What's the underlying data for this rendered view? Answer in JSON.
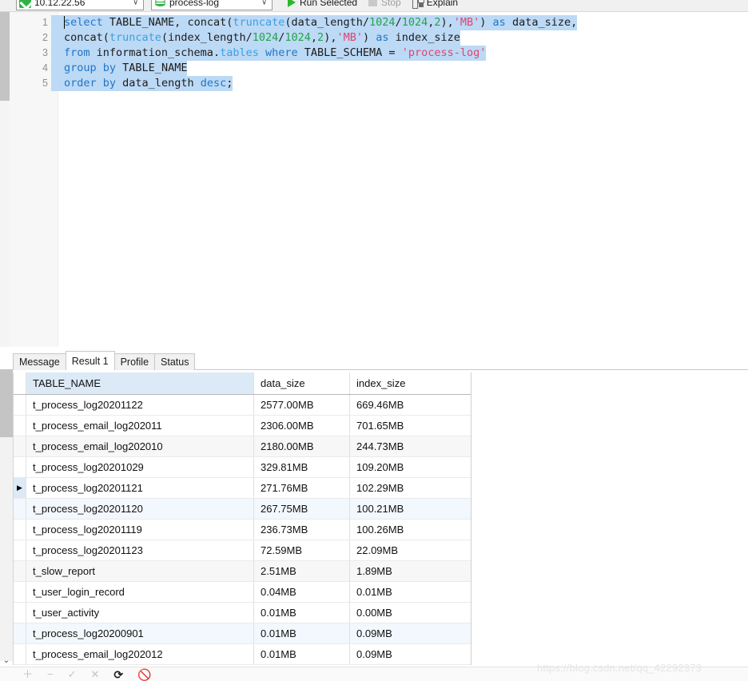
{
  "toolbar": {
    "connection": {
      "value": "10.12.22.56",
      "icon": "plug-icon",
      "arrow": "∨"
    },
    "database": {
      "value": "process-log",
      "icon": "database-icon",
      "arrow": "∨"
    },
    "run_selected_label": "Run Selected",
    "stop_label": "Stop",
    "explain_label": "Explain"
  },
  "editor": {
    "line_numbers": [
      "1",
      "2",
      "3",
      "4",
      "5"
    ],
    "lines": [
      {
        "n": "1",
        "tokens": [
          {
            "t": "select ",
            "c": "kw"
          },
          {
            "t": "TABLE_NAME, concat(",
            "c": "pl"
          },
          {
            "t": "truncate",
            "c": "fn"
          },
          {
            "t": "(data_length/",
            "c": "pl"
          },
          {
            "t": "1024",
            "c": "num"
          },
          {
            "t": "/",
            "c": "pl"
          },
          {
            "t": "1024",
            "c": "num"
          },
          {
            "t": ",",
            "c": "pl"
          },
          {
            "t": "2",
            "c": "num"
          },
          {
            "t": "),",
            "c": "pl"
          },
          {
            "t": "'MB'",
            "c": "str"
          },
          {
            "t": ") ",
            "c": "pl"
          },
          {
            "t": "as ",
            "c": "kw"
          },
          {
            "t": "data_size,",
            "c": "pl"
          }
        ]
      },
      {
        "n": "2",
        "tokens": [
          {
            "t": "concat(",
            "c": "pl"
          },
          {
            "t": "truncate",
            "c": "fn"
          },
          {
            "t": "(index_length/",
            "c": "pl"
          },
          {
            "t": "1024",
            "c": "num"
          },
          {
            "t": "/",
            "c": "pl"
          },
          {
            "t": "1024",
            "c": "num"
          },
          {
            "t": ",",
            "c": "pl"
          },
          {
            "t": "2",
            "c": "num"
          },
          {
            "t": "),",
            "c": "pl"
          },
          {
            "t": "'MB'",
            "c": "str"
          },
          {
            "t": ") ",
            "c": "pl"
          },
          {
            "t": "as ",
            "c": "kw"
          },
          {
            "t": "index_size",
            "c": "pl"
          }
        ]
      },
      {
        "n": "3",
        "tokens": [
          {
            "t": "from ",
            "c": "kw"
          },
          {
            "t": "information_schema.",
            "c": "pl"
          },
          {
            "t": "tables ",
            "c": "tbl"
          },
          {
            "t": "where ",
            "c": "kw"
          },
          {
            "t": "TABLE_SCHEMA = ",
            "c": "pl"
          },
          {
            "t": "'process-log'",
            "c": "str"
          }
        ]
      },
      {
        "n": "4",
        "tokens": [
          {
            "t": "group ",
            "c": "kw"
          },
          {
            "t": "by ",
            "c": "kw"
          },
          {
            "t": "TABLE_NAME",
            "c": "pl"
          }
        ]
      },
      {
        "n": "5",
        "tokens": [
          {
            "t": "order ",
            "c": "kw"
          },
          {
            "t": "by ",
            "c": "kw"
          },
          {
            "t": "data_length ",
            "c": "pl"
          },
          {
            "t": "desc",
            "c": "kw"
          },
          {
            "t": ";",
            "c": "pl"
          }
        ]
      }
    ]
  },
  "result": {
    "tabs": [
      {
        "label": "Message",
        "active": false
      },
      {
        "label": "Result 1",
        "active": true
      },
      {
        "label": "Profile",
        "active": false
      },
      {
        "label": "Status",
        "active": false
      }
    ],
    "columns": [
      "TABLE_NAME",
      "data_size",
      "index_size"
    ],
    "rows": [
      {
        "name": "t_process_log20201122",
        "data_size": "2577.00MB",
        "index_size": "669.46MB",
        "style": "plain",
        "current": false
      },
      {
        "name": "t_process_email_log202011",
        "data_size": "2306.00MB",
        "index_size": "701.65MB",
        "style": "plain",
        "current": false
      },
      {
        "name": "t_process_email_log202010",
        "data_size": "2180.00MB",
        "index_size": "244.73MB",
        "style": "alt",
        "current": false
      },
      {
        "name": "t_process_log20201029",
        "data_size": "329.81MB",
        "index_size": "109.20MB",
        "style": "plain",
        "current": false
      },
      {
        "name": "t_process_log20201121",
        "data_size": "271.76MB",
        "index_size": "102.29MB",
        "style": "plain",
        "current": true
      },
      {
        "name": "t_process_log20201120",
        "data_size": "267.75MB",
        "index_size": "100.21MB",
        "style": "sel2",
        "current": false
      },
      {
        "name": "t_process_log20201119",
        "data_size": "236.73MB",
        "index_size": "100.26MB",
        "style": "plain",
        "current": false
      },
      {
        "name": "t_process_log20201123",
        "data_size": "72.59MB",
        "index_size": "22.09MB",
        "style": "plain",
        "current": false
      },
      {
        "name": "t_slow_report",
        "data_size": "2.51MB",
        "index_size": "1.89MB",
        "style": "alt",
        "current": false
      },
      {
        "name": "t_user_login_record",
        "data_size": "0.04MB",
        "index_size": "0.01MB",
        "style": "plain",
        "current": false
      },
      {
        "name": "t_user_activity",
        "data_size": "0.01MB",
        "index_size": "0.00MB",
        "style": "plain",
        "current": false
      },
      {
        "name": "t_process_log20200901",
        "data_size": "0.01MB",
        "index_size": "0.09MB",
        "style": "sel2",
        "current": false
      },
      {
        "name": "t_process_email_log202012",
        "data_size": "0.01MB",
        "index_size": "0.09MB",
        "style": "plain",
        "current": false
      }
    ],
    "row_indicator_glyph": "▶"
  },
  "bottom_toolbar": {
    "buttons": [
      {
        "name": "add-row-button",
        "glyph": "＋",
        "enabled": false
      },
      {
        "name": "delete-row-button",
        "glyph": "−",
        "enabled": false
      },
      {
        "name": "confirm-button",
        "glyph": "✓",
        "enabled": false
      },
      {
        "name": "cancel-button",
        "glyph": "✕",
        "enabled": false
      },
      {
        "name": "refresh-button",
        "glyph": "⟳",
        "enabled": true
      },
      {
        "name": "stop-button",
        "glyph": "🚫",
        "enabled": true
      }
    ]
  },
  "watermark": {
    "text": "https://blog.csdn.net/qq_42292373"
  },
  "colors": {
    "accent_green": "#2fb344",
    "keyword_blue": "#2176c7",
    "function_blue": "#3e9fe0",
    "number_green": "#23a34a",
    "string_pink": "#e0436f",
    "selection_blue": "#bcd9f5",
    "header_blue": "#dceaf7"
  }
}
